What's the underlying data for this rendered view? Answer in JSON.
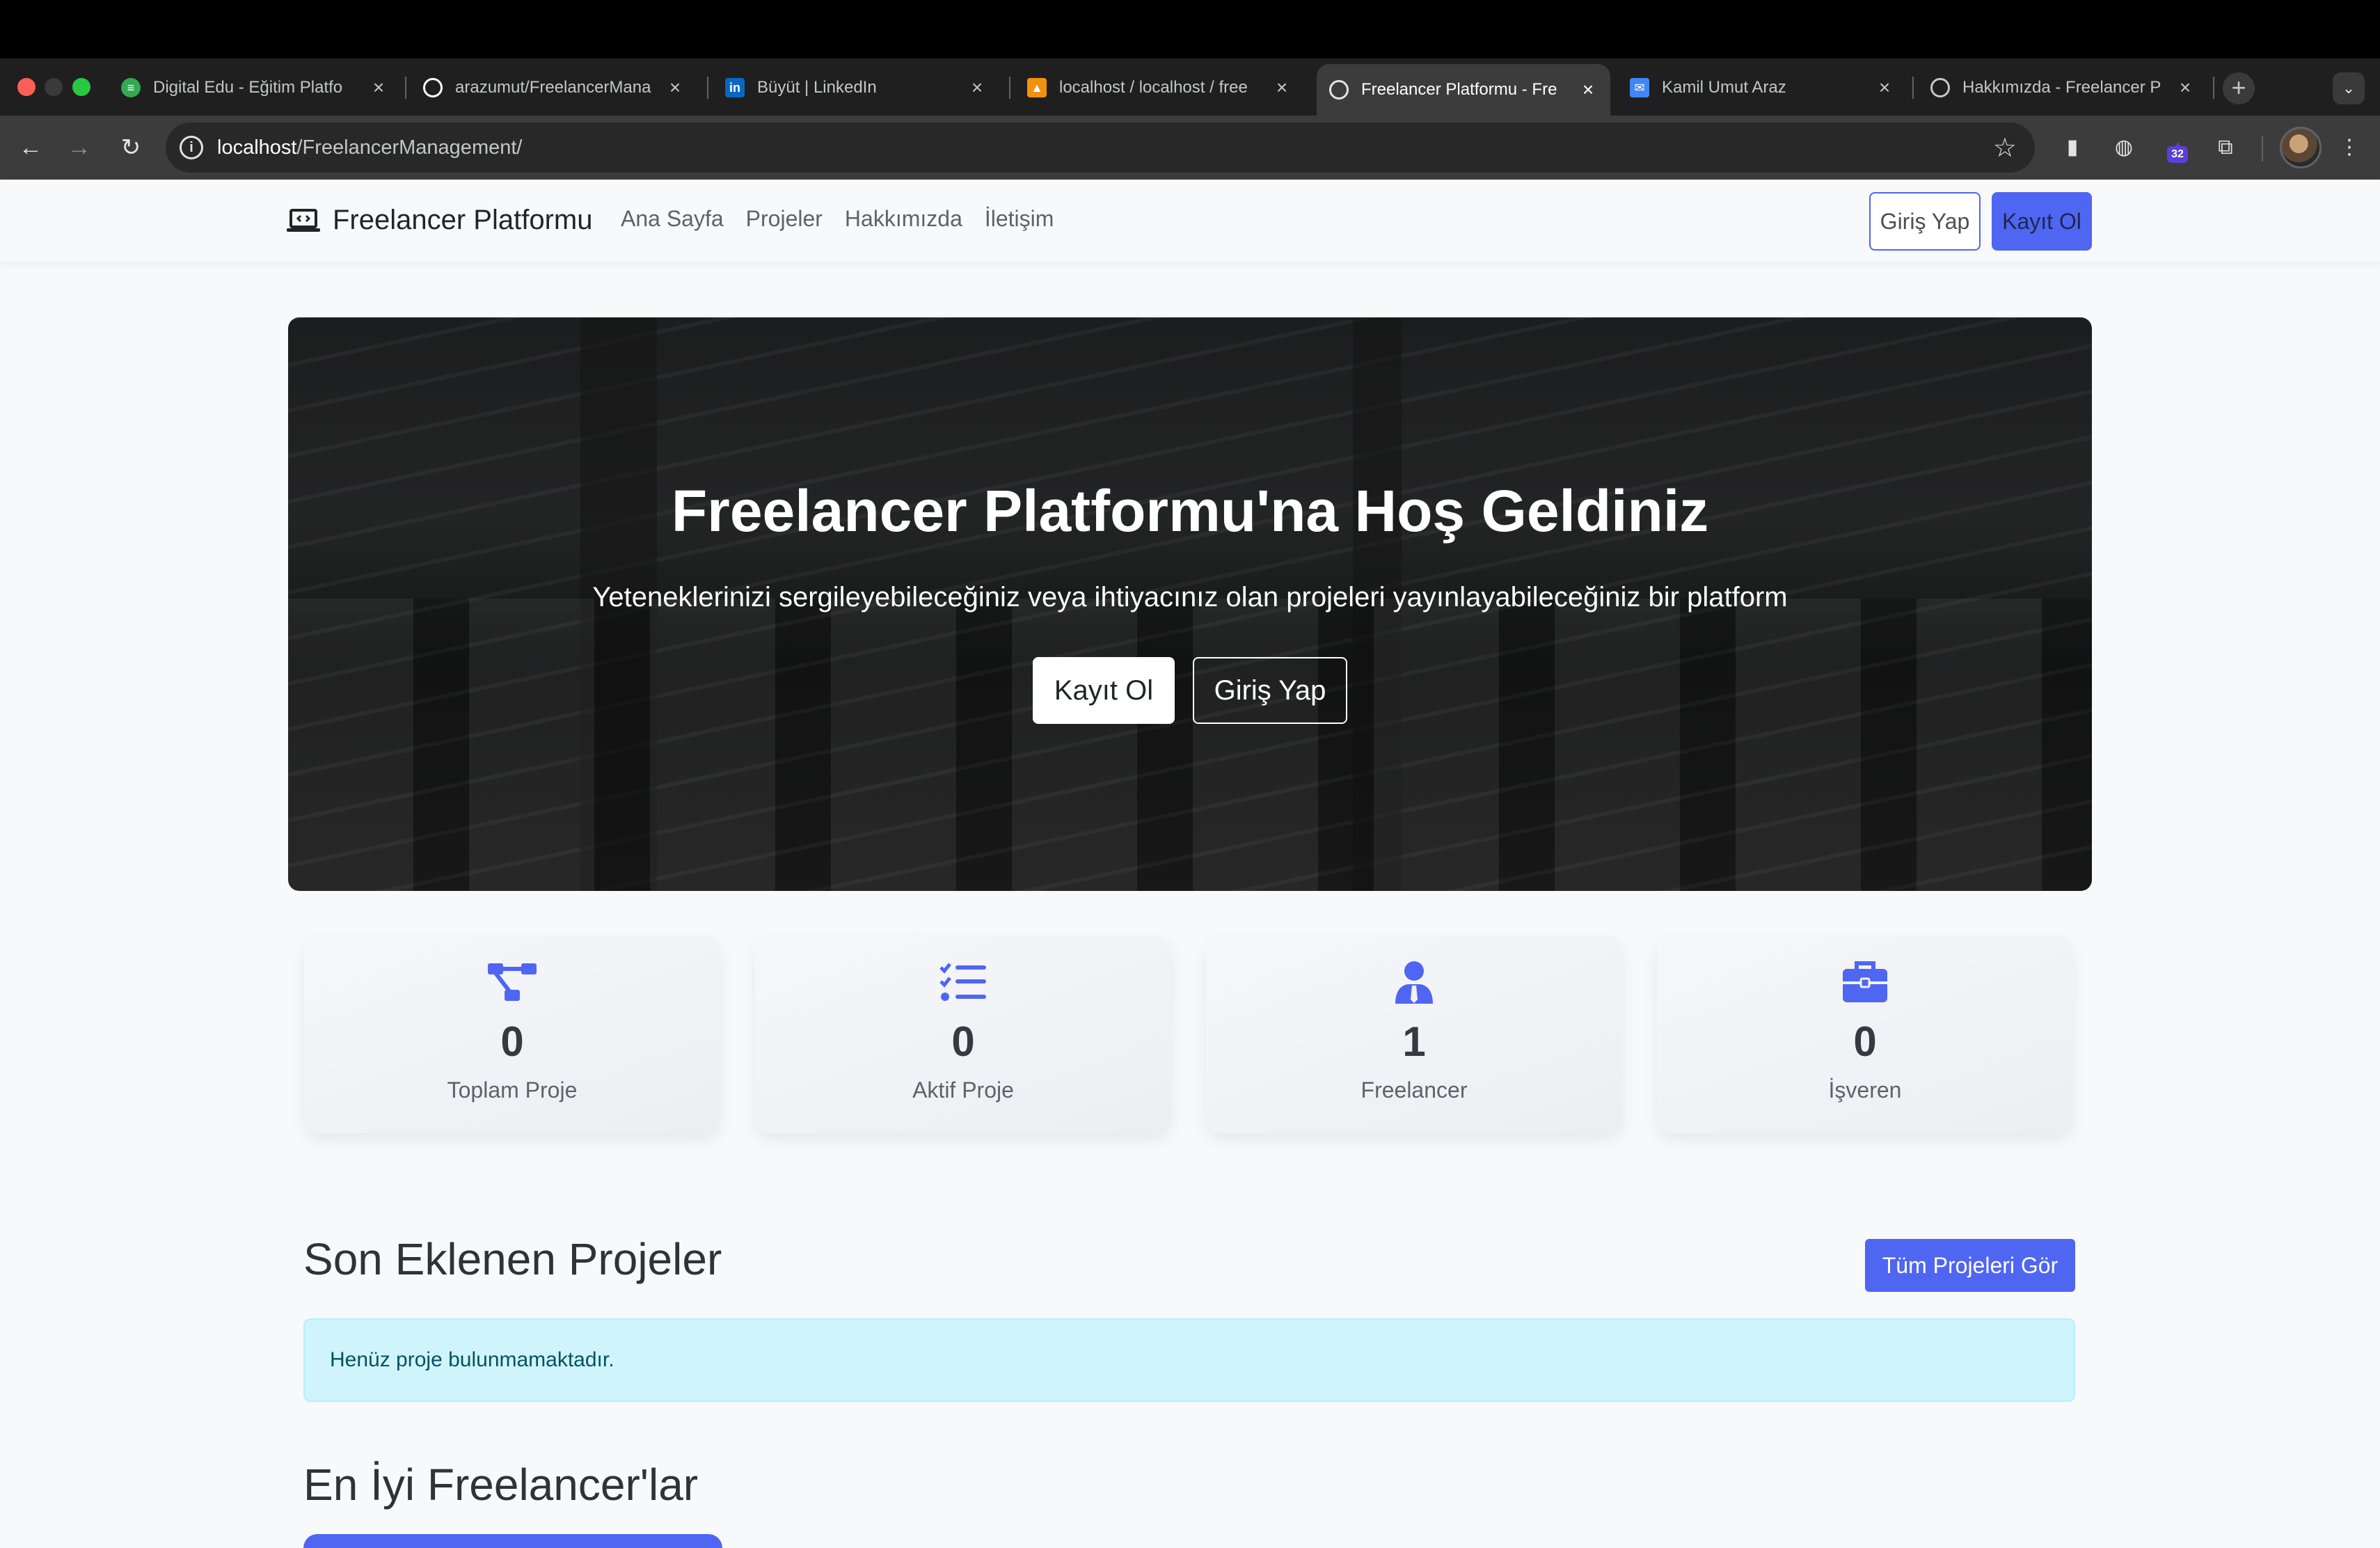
{
  "browser": {
    "tabs": [
      {
        "title": "Digital Edu - Eğitim Platfo",
        "favicon": "stack-icon",
        "favicon_color": "#34a853"
      },
      {
        "title": "arazumut/FreelancerMana",
        "favicon": "github-icon",
        "favicon_color": "#ffffff"
      },
      {
        "title": "Büyüt | LinkedIn",
        "favicon": "linkedin-icon",
        "favicon_color": "#0a66c2"
      },
      {
        "title": "localhost / localhost / free",
        "favicon": "phpmyadmin-icon",
        "favicon_color": "#f29111"
      },
      {
        "title": "Freelancer Platformu - Fre",
        "favicon": "globe-icon",
        "favicon_color": "#e3e3e3",
        "active": true
      },
      {
        "title": "Kamil Umut Araz",
        "favicon": "mail-icon",
        "favicon_color": "#4285f4"
      },
      {
        "title": "Hakkımızda - Freelancer P",
        "favicon": "globe-icon",
        "favicon_color": "#e3e3e3"
      }
    ],
    "url_host": "localhost",
    "url_path": "/FreelancerManagement/",
    "extension_badge": "32"
  },
  "site": {
    "brand": "Freelancer Platformu",
    "nav": [
      "Ana Sayfa",
      "Projeler",
      "Hakkımızda",
      "İletişim"
    ],
    "login_label": "Giriş Yap",
    "register_label": "Kayıt Ol"
  },
  "hero": {
    "title": "Freelancer Platformu'na Hoş Geldiniz",
    "subtitle": "Yeteneklerinizi sergileyebileceğiniz veya ihtiyacınız olan projeleri yayınlayabileceğiniz bir platform",
    "register_label": "Kayıt Ol",
    "login_label": "Giriş Yap"
  },
  "stats": [
    {
      "value": "0",
      "label": "Toplam Proje",
      "icon": "project-diagram-icon"
    },
    {
      "value": "0",
      "label": "Aktif Proje",
      "icon": "tasks-icon"
    },
    {
      "value": "1",
      "label": "Freelancer",
      "icon": "user-tie-icon"
    },
    {
      "value": "0",
      "label": "İşveren",
      "icon": "briefcase-icon"
    }
  ],
  "recent_projects": {
    "title": "Son Eklenen Projeler",
    "view_all_label": "Tüm Projeleri Gör",
    "empty_message": "Henüz proje bulunmamaktadır."
  },
  "top_freelancers": {
    "title": "En İyi Freelancer'lar"
  },
  "colors": {
    "primary": "#4f66f2",
    "alert_bg": "#cff4fc",
    "alert_text": "#055160"
  }
}
